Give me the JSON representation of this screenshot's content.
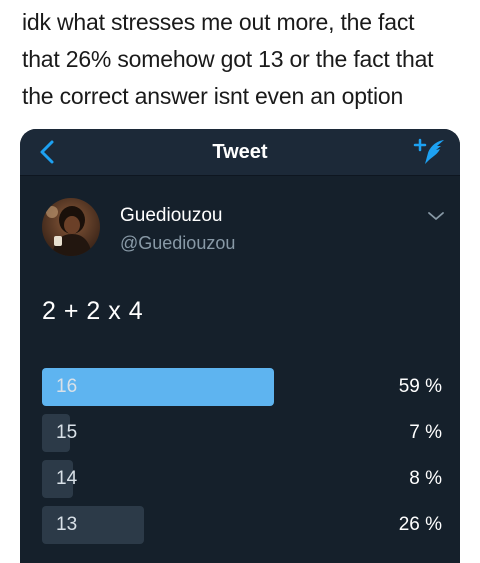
{
  "caption": {
    "line1": "idk what stresses me out more, the fact",
    "line2": "that 26% somehow got 13 or the fact that",
    "line3": "the correct answer isnt even an option"
  },
  "nav": {
    "title": "Tweet",
    "back_icon": "chevron-left-icon",
    "compose_icon": "compose-tweet-icon"
  },
  "user": {
    "display_name": "Guediouzou",
    "handle": "@Guediouzou"
  },
  "tweet": {
    "text": "2 + 2 x 4"
  },
  "poll": {
    "options": [
      {
        "label": "16",
        "percent_text": "59 %",
        "percent": 59,
        "winner": true
      },
      {
        "label": "15",
        "percent_text": "7 %",
        "percent": 7,
        "winner": false
      },
      {
        "label": "14",
        "percent_text": "8 %",
        "percent": 8,
        "winner": false
      },
      {
        "label": "13",
        "percent_text": "26 %",
        "percent": 26,
        "winner": false
      }
    ]
  },
  "colors": {
    "background": "#15202b",
    "accent": "#1da1f2",
    "winner_bar": "#5eb4f0",
    "bar": "#2c3a48"
  }
}
